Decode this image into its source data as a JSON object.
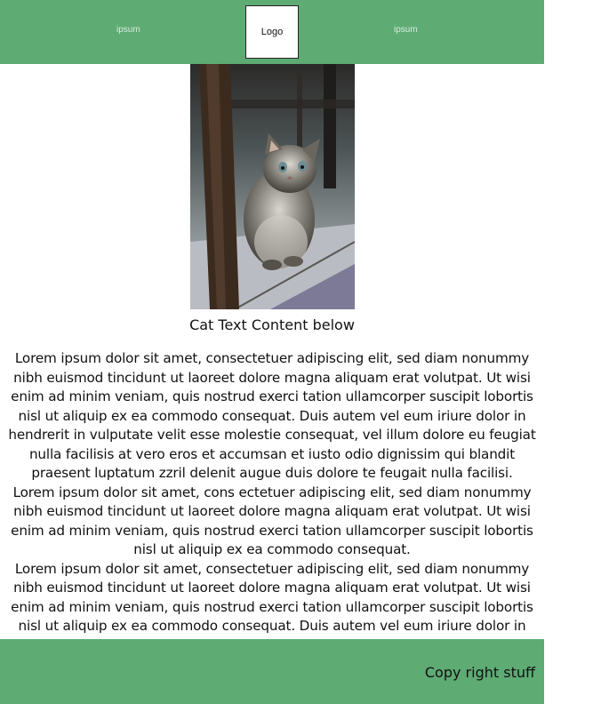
{
  "header": {
    "nav_left": "ipsum",
    "nav_right": "ipsum",
    "logo": "Logo",
    "background": "#5eab74"
  },
  "hero": {
    "subject": "kitten photo"
  },
  "content": {
    "caption": "Cat Text Content below",
    "paragraphs": [
      "Lorem ipsum dolor sit amet, consectetuer adipiscing elit, sed diam nonummy nibh euismod tincidunt ut laoreet dolore magna aliquam erat volutpat. Ut wisi enim ad minim veniam, quis nostrud exerci tation ullamcorper suscipit lobortis nisl ut aliquip ex ea commodo consequat. Duis autem vel eum iriure dolor in hendrerit in vulputate velit esse molestie consequat, vel illum dolore eu feugiat nulla facilisis at vero eros et accumsan et iusto odio dignissim qui blandit praesent luptatum zzril delenit augue duis dolore te feugait nulla facilisi.",
      "Lorem ipsum dolor sit amet, cons ectetuer adipiscing elit, sed diam nonummy nibh euismod tincidunt ut laoreet dolore magna aliquam erat volutpat. Ut wisi enim ad minim veniam, quis nostrud exerci tation ullamcorper suscipit lobortis nisl ut aliquip ex ea commodo consequat.",
      "Lorem ipsum dolor sit amet, consectetuer adipiscing elit, sed diam nonummy nibh euismod tincidunt ut laoreet dolore magna aliquam erat volutpat. Ut wisi enim ad minim veniam, quis nostrud exerci tation ullamcorper suscipit lobortis nisl ut aliquip ex ea commodo consequat. Duis autem vel eum iriure dolor in hendrerit in vulputate velit esse molestie consequat, vel illum dolore eu feugiat nulla facilisis at vero eros et accumsan et iusto odio dignissim qui blandit praesent luptatum zzril delenit augue duis dolore te feugait nulla facilisi."
    ]
  },
  "footer": {
    "copyright": "Copy right stuff",
    "background": "#5eab74"
  }
}
